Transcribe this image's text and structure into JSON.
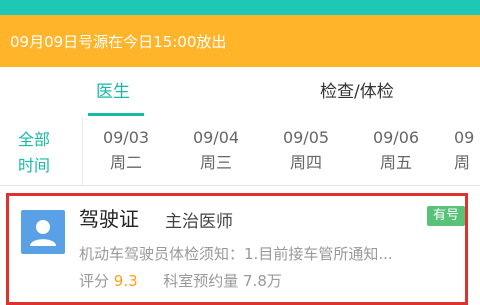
{
  "colors": {
    "teal_accent": "#19b9a7",
    "notice_bg": "#ffb42a",
    "badge_bg": "#57c278",
    "card_highlight_border": "#e03131",
    "rating_value": "#ff9f1a"
  },
  "notice": {
    "text": "09月09日号源在今日15:00放出"
  },
  "tabs": [
    {
      "label": "医生",
      "active": true
    },
    {
      "label": "检查/体检",
      "active": false
    }
  ],
  "date_filter": {
    "all_label_line1": "全部",
    "all_label_line2": "时间",
    "dates": [
      {
        "date": "09/03",
        "weekday": "周二"
      },
      {
        "date": "09/04",
        "weekday": "周三"
      },
      {
        "date": "09/05",
        "weekday": "周四"
      },
      {
        "date": "09/06",
        "weekday": "周五"
      },
      {
        "date": "09",
        "weekday": "周"
      }
    ]
  },
  "doctor_card": {
    "avatar_icon": "person-avatar-icon",
    "name": "驾驶证",
    "title": "主治医师",
    "badge": "有号",
    "notice": "机动车驾驶员体检须知：1.目前接车管所通知...",
    "rating_label": "评分",
    "rating_value": "9.3",
    "booking_label": "科室预约量",
    "booking_value": "7.8万"
  }
}
